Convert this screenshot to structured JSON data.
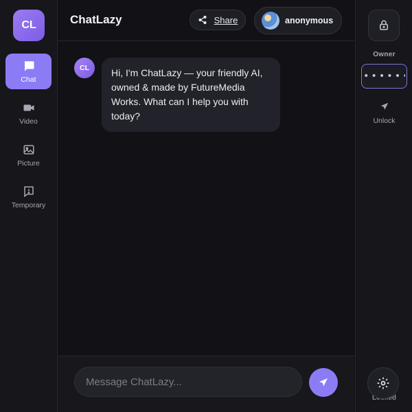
{
  "app": {
    "logo_text": "CL",
    "title": "ChatLazy"
  },
  "sidebar_left": {
    "items": [
      {
        "label": "Chat",
        "icon": "chat-bubble-icon",
        "active": true
      },
      {
        "label": "Video",
        "icon": "video-icon",
        "active": false
      },
      {
        "label": "Picture",
        "icon": "image-icon",
        "active": false
      },
      {
        "label": "Temporary",
        "icon": "alert-icon",
        "active": false
      }
    ]
  },
  "header": {
    "share_label": "Share",
    "user_name": "anonymous"
  },
  "messages": [
    {
      "sender_initials": "CL",
      "text": "Hi, I'm ChatLazy — your friendly AI, owned & made by FutureMedia Works. What can I help you with today?"
    }
  ],
  "composer": {
    "placeholder": "Message ChatLazy..."
  },
  "sidebar_right": {
    "owner_label": "Owner",
    "password_value": "••••••",
    "unlock_label": "Unlock",
    "status_label": "Locked"
  },
  "colors": {
    "accent": "#8b7cf6",
    "background": "#121216",
    "panel": "#16161b",
    "bubble": "#22222a"
  }
}
